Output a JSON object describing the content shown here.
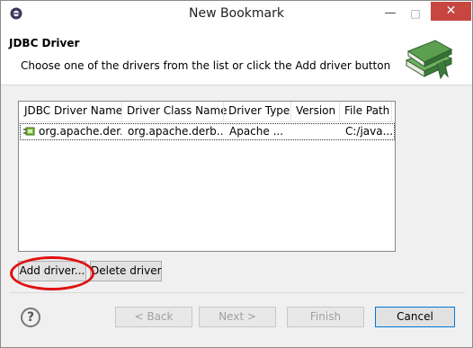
{
  "window": {
    "title": "New Bookmark"
  },
  "banner": {
    "title": "JDBC Driver",
    "description": "Choose one of the drivers from the list or click the Add driver button"
  },
  "table": {
    "columns": [
      "JDBC Driver Name",
      "Driver Class Name",
      "Driver Type",
      "Version",
      "File Path"
    ],
    "rows": [
      {
        "name": "org.apache.der...",
        "class_name": "org.apache.derb...",
        "type": "Apache ...",
        "version": "",
        "path": "C:/java..."
      }
    ]
  },
  "actions": {
    "add_driver": "Add driver...",
    "delete_driver": "Delete driver"
  },
  "footer": {
    "back": "< Back",
    "next": "Next >",
    "finish": "Finish",
    "cancel": "Cancel"
  },
  "icons": {
    "app": "eclipse-icon",
    "banner": "books-icon",
    "driver": "database-driver-icon",
    "help": "help-icon"
  },
  "colors": {
    "close": "#c7463f",
    "annotation": "#e01010",
    "books": "#3a7a3a"
  }
}
